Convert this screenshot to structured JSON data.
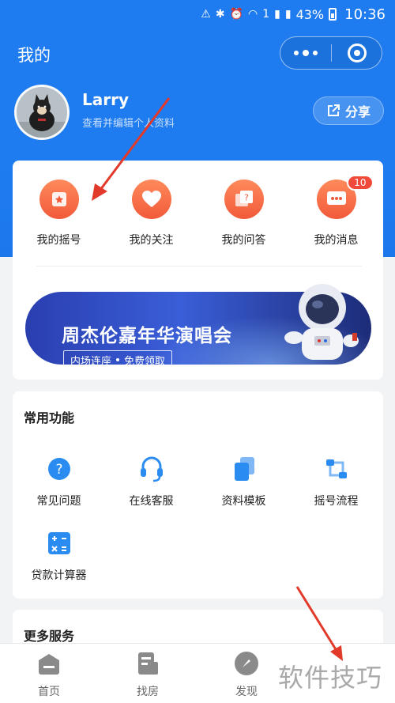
{
  "status_bar": {
    "battery": "43%",
    "time": "10:36",
    "sim_badge": "1"
  },
  "header": {
    "title": "我的"
  },
  "profile": {
    "name": "Larry",
    "hint": "查看并编辑个人资料",
    "share_label": "分享"
  },
  "quick_actions": [
    {
      "label": "我的摇号",
      "icon": "star-card-icon"
    },
    {
      "label": "我的关注",
      "icon": "heart-icon"
    },
    {
      "label": "我的问答",
      "icon": "qa-icon"
    },
    {
      "label": "我的消息",
      "icon": "message-icon",
      "badge": "10"
    }
  ],
  "banner": {
    "title": "周杰伦嘉年华演唱会",
    "tag_left": "内场连座",
    "tag_right": "免费领取"
  },
  "common": {
    "title": "常用功能",
    "items": [
      {
        "label": "常见问题",
        "icon": "question-icon"
      },
      {
        "label": "在线客服",
        "icon": "headset-icon"
      },
      {
        "label": "资料模板",
        "icon": "document-icon"
      },
      {
        "label": "摇号流程",
        "icon": "flow-icon"
      },
      {
        "label": "贷款计算器",
        "icon": "calculator-icon"
      }
    ]
  },
  "more": {
    "title": "更多服务"
  },
  "tabbar": [
    {
      "label": "首页",
      "icon": "home-icon"
    },
    {
      "label": "找房",
      "icon": "house-search-icon"
    },
    {
      "label": "发现",
      "icon": "compass-icon"
    }
  ],
  "watermark": "软件技巧",
  "colors": {
    "primary": "#1f7cf0",
    "accent": "#f15a3a",
    "badge": "#f24a3a"
  }
}
